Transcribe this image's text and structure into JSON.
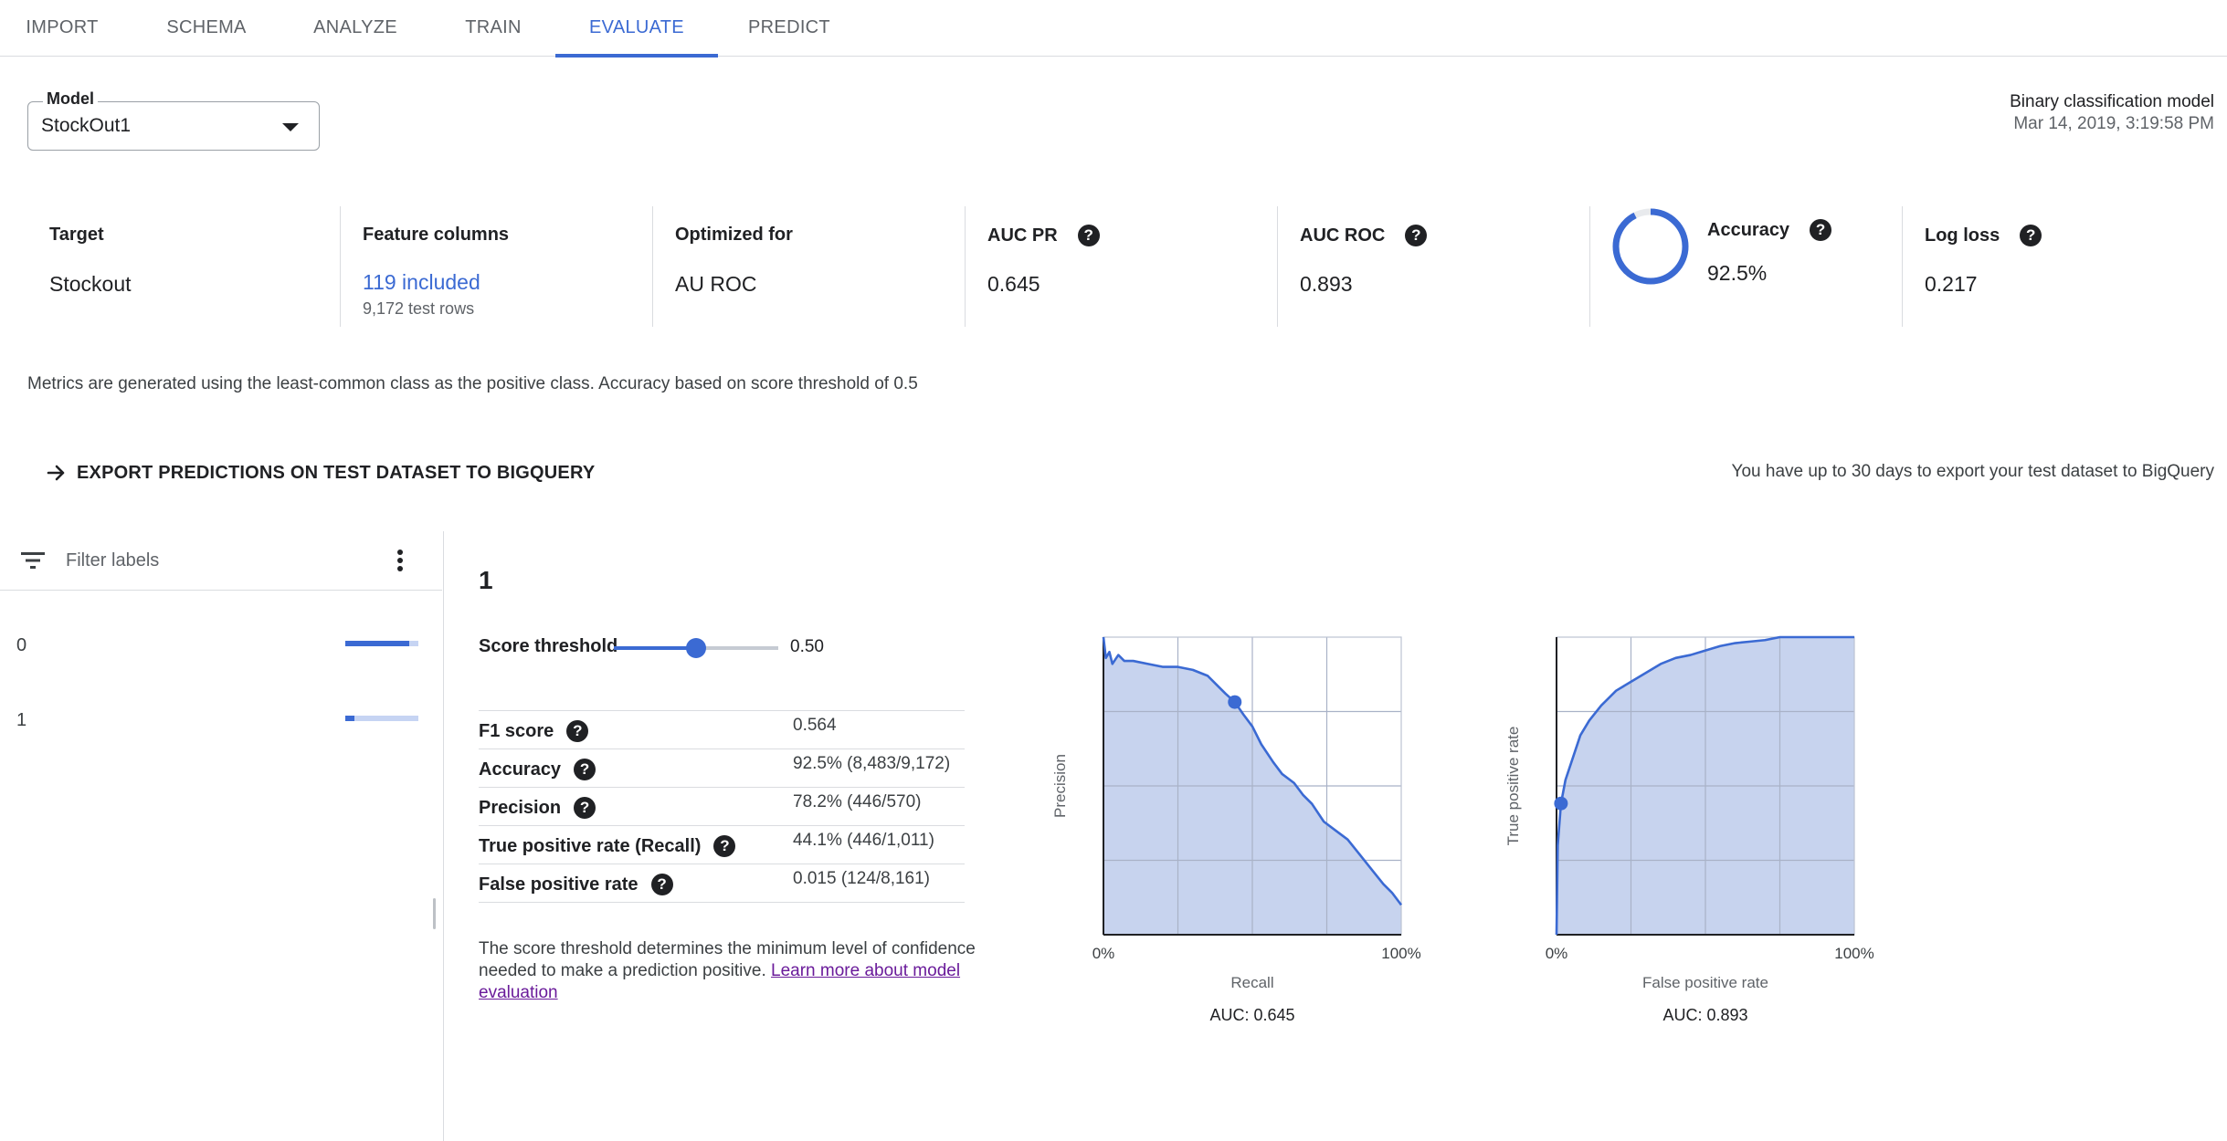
{
  "tabs": [
    {
      "label": "IMPORT",
      "active": false
    },
    {
      "label": "SCHEMA",
      "active": false
    },
    {
      "label": "ANALYZE",
      "active": false
    },
    {
      "label": "TRAIN",
      "active": false
    },
    {
      "label": "EVALUATE",
      "active": true
    },
    {
      "label": "PREDICT",
      "active": false
    }
  ],
  "model": {
    "label": "Model",
    "value": "StockOut1",
    "type": "Binary classification model",
    "date": "Mar 14, 2019, 3:19:58 PM"
  },
  "metrics": {
    "target": {
      "title": "Target",
      "value": "Stockout"
    },
    "features": {
      "title": "Feature columns",
      "link": "119 included",
      "sub": "9,172 test rows"
    },
    "optimized": {
      "title": "Optimized for",
      "value": "AU ROC"
    },
    "auc_pr": {
      "title": "AUC PR",
      "value": "0.645"
    },
    "auc_roc": {
      "title": "AUC ROC",
      "value": "0.893"
    },
    "accuracy": {
      "title": "Accuracy",
      "value": "92.5%",
      "fraction": 0.925
    },
    "log_loss": {
      "title": "Log loss",
      "value": "0.217"
    }
  },
  "note": "Metrics are generated using the least-common class as the positive class. Accuracy based on score threshold of 0.5",
  "export": {
    "button_label": "EXPORT PREDICTIONS ON TEST DATASET TO BIGQUERY",
    "note": "You have up to 30 days to export your test dataset to BigQuery"
  },
  "filter": {
    "placeholder": "Filter labels"
  },
  "labels": [
    {
      "name": "0",
      "share": 0.88
    },
    {
      "name": "1",
      "share": 0.12
    }
  ],
  "selected_label": "1",
  "threshold": {
    "label": "Score threshold",
    "value": "0.50",
    "fraction": 0.5
  },
  "stats": [
    {
      "name": "F1 score",
      "value": "0.564"
    },
    {
      "name": "Accuracy",
      "value": "92.5% (8,483/9,172)"
    },
    {
      "name": "Precision",
      "value": "78.2% (446/570)"
    },
    {
      "name": "True positive rate (Recall)",
      "value": "44.1% (446/1,011)"
    },
    {
      "name": "False positive rate",
      "value": "0.015 (124/8,161)"
    }
  ],
  "explain": {
    "text": "The score threshold determines the minimum level of confidence needed to make a prediction positive. ",
    "link": "Learn more about model evaluation"
  },
  "colors": {
    "accent": "#3b6ad3",
    "area_fill": "#c7d3ee",
    "link_visited": "#6a1b9a"
  },
  "chart_data": [
    {
      "type": "area",
      "xlabel": "Recall",
      "ylabel": "Precision",
      "x_ticks": [
        "0%",
        "100%"
      ],
      "xlim": [
        0,
        1
      ],
      "ylim": [
        0,
        1
      ],
      "grid": true,
      "auc_label": "AUC: 0.645",
      "marker": {
        "x": 0.441,
        "y": 0.782
      },
      "points": [
        [
          0.0,
          1.0
        ],
        [
          0.008,
          0.93
        ],
        [
          0.02,
          0.95
        ],
        [
          0.03,
          0.91
        ],
        [
          0.05,
          0.94
        ],
        [
          0.07,
          0.92
        ],
        [
          0.1,
          0.92
        ],
        [
          0.15,
          0.91
        ],
        [
          0.2,
          0.9
        ],
        [
          0.25,
          0.9
        ],
        [
          0.3,
          0.89
        ],
        [
          0.35,
          0.87
        ],
        [
          0.38,
          0.84
        ],
        [
          0.41,
          0.81
        ],
        [
          0.441,
          0.782
        ],
        [
          0.47,
          0.74
        ],
        [
          0.5,
          0.7
        ],
        [
          0.53,
          0.64
        ],
        [
          0.57,
          0.58
        ],
        [
          0.6,
          0.54
        ],
        [
          0.64,
          0.51
        ],
        [
          0.67,
          0.47
        ],
        [
          0.7,
          0.44
        ],
        [
          0.74,
          0.38
        ],
        [
          0.78,
          0.35
        ],
        [
          0.82,
          0.32
        ],
        [
          0.86,
          0.27
        ],
        [
          0.9,
          0.22
        ],
        [
          0.94,
          0.17
        ],
        [
          0.97,
          0.14
        ],
        [
          1.0,
          0.1
        ]
      ]
    },
    {
      "type": "area",
      "xlabel": "False positive rate",
      "ylabel": "True positive rate",
      "x_ticks": [
        "0%",
        "100%"
      ],
      "xlim": [
        0,
        1
      ],
      "ylim": [
        0,
        1
      ],
      "grid": true,
      "auc_label": "AUC: 0.893",
      "marker": {
        "x": 0.015,
        "y": 0.441
      },
      "points": [
        [
          0.0,
          0.0
        ],
        [
          0.004,
          0.3
        ],
        [
          0.015,
          0.441
        ],
        [
          0.03,
          0.52
        ],
        [
          0.05,
          0.58
        ],
        [
          0.08,
          0.67
        ],
        [
          0.11,
          0.72
        ],
        [
          0.15,
          0.77
        ],
        [
          0.2,
          0.82
        ],
        [
          0.25,
          0.85
        ],
        [
          0.3,
          0.88
        ],
        [
          0.35,
          0.91
        ],
        [
          0.4,
          0.93
        ],
        [
          0.45,
          0.94
        ],
        [
          0.5,
          0.955
        ],
        [
          0.55,
          0.97
        ],
        [
          0.6,
          0.98
        ],
        [
          0.65,
          0.985
        ],
        [
          0.7,
          0.99
        ],
        [
          0.75,
          1.0
        ],
        [
          0.8,
          1.0
        ],
        [
          0.9,
          1.0
        ],
        [
          1.0,
          1.0
        ]
      ]
    }
  ]
}
